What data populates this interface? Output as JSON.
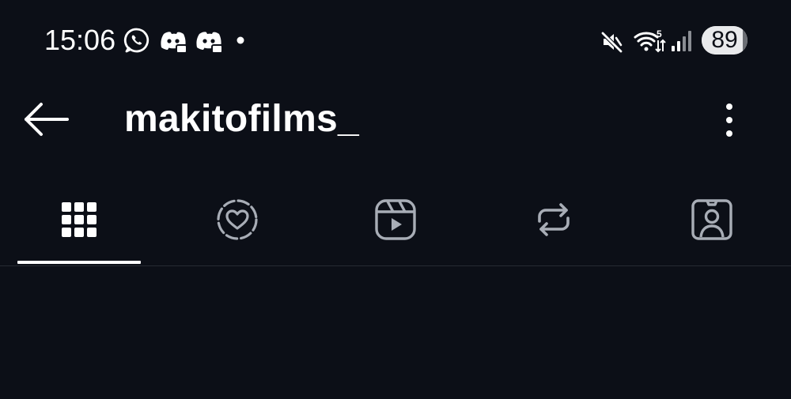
{
  "status_bar": {
    "time": "15:06",
    "notification_icons": [
      "whatsapp-icon",
      "discord-icon",
      "discord-icon",
      "dot-icon"
    ],
    "system_icons": [
      "mute-icon",
      "wifi-icon",
      "signal-icon"
    ],
    "battery_level": 89,
    "battery_text": "89"
  },
  "header": {
    "username": "makitofilms_",
    "back_icon": "arrow-left-icon",
    "more_icon": "more-vertical-icon"
  },
  "tabs": [
    {
      "id": "posts",
      "icon": "grid-icon",
      "active": true
    },
    {
      "id": "highlights",
      "icon": "heart-circle-icon",
      "active": false
    },
    {
      "id": "reels",
      "icon": "reels-icon",
      "active": false
    },
    {
      "id": "reposts",
      "icon": "repost-icon",
      "active": false
    },
    {
      "id": "tagged",
      "icon": "tagged-user-icon",
      "active": false
    }
  ],
  "colors": {
    "background": "#0c0f17",
    "text": "#ffffff",
    "inactive_icon": "#a8adb6",
    "divider": "#262a33"
  }
}
